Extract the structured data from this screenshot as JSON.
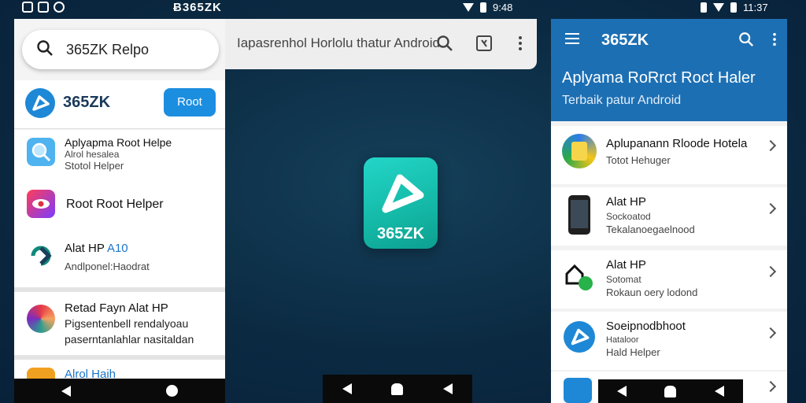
{
  "status": {
    "center_text": "Ƀ365ZK",
    "mid_time": "9:48",
    "right_time": "11:37"
  },
  "browser": {
    "url_text": "Iapasrenhol Horlolu thatur Android"
  },
  "left_panel": {
    "search_query": "365ZK Relpo",
    "brand_name": "365ZK",
    "root_button": "Root",
    "items": [
      {
        "title": "Aplyapma Root Helpe",
        "sub1": "Alrol hesalea",
        "sub2": "Stotol Helper"
      },
      {
        "title": "Root Root Helper"
      },
      {
        "title": "Alat HP",
        "title_accent": "A10",
        "sub1": "Andlponel:Haodrat"
      },
      {
        "title": "Retad Fayn Alat HP",
        "sub1": "Pigsentenbell rendalyoau",
        "sub2": "paserntanlahlar nasitaldan"
      },
      {
        "title": "Alrol Haih"
      }
    ]
  },
  "center_app": {
    "label": "365ZK"
  },
  "right_panel": {
    "title": "365ZK",
    "headline": "Aplyama RoRrct Roct Haler",
    "subheadline": "Terbaik patur Android",
    "items": [
      {
        "title": "Aplupanann Rloode Hotela",
        "sub1": "Totot Hehuger"
      },
      {
        "title": "Alat HP",
        "sub1": "Sockoatod",
        "sub2": "Tekalanoegaelnood"
      },
      {
        "title": "Alat HP",
        "sub1": "Sotomat",
        "sub2": "Rokaun oery lodond"
      },
      {
        "title": "Soeipnodbhoot",
        "sub1": "Hataloor",
        "sub2": "Hald Helper"
      }
    ]
  },
  "colors": {
    "accent_blue": "#1c8ee0",
    "header_blue": "#1d6fb3",
    "app_teal": "#14b8a6"
  }
}
